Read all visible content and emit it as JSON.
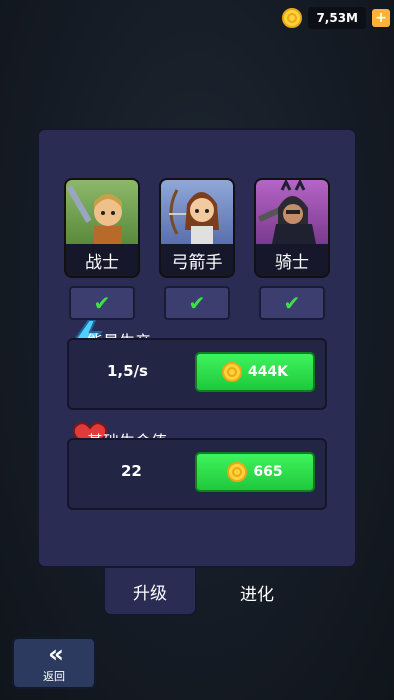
{
  "currency": {
    "amount": "7,53M",
    "coin_icon": "coin-icon",
    "plus_icon": "plus-icon"
  },
  "heroes": [
    {
      "name": "战士",
      "unlocked": true
    },
    {
      "name": "弓箭手",
      "unlocked": true
    },
    {
      "name": "骑士",
      "unlocked": true
    }
  ],
  "energy": {
    "title": "能量生产",
    "value": "1,5/s",
    "cost": "444K",
    "icon": "lightning-icon"
  },
  "health": {
    "title": "基础生命值",
    "value": "22",
    "cost": "665",
    "icon": "heart-icon"
  },
  "tabs": {
    "upgrade": "升级",
    "evolve": "进化"
  },
  "back": {
    "label": "返回",
    "icon": "double-chevron-left-icon"
  },
  "colors": {
    "panel": "#2a2c54",
    "button_green": "#2fdc4a",
    "check": "#3ee04a",
    "coin": "#ffd23a"
  }
}
